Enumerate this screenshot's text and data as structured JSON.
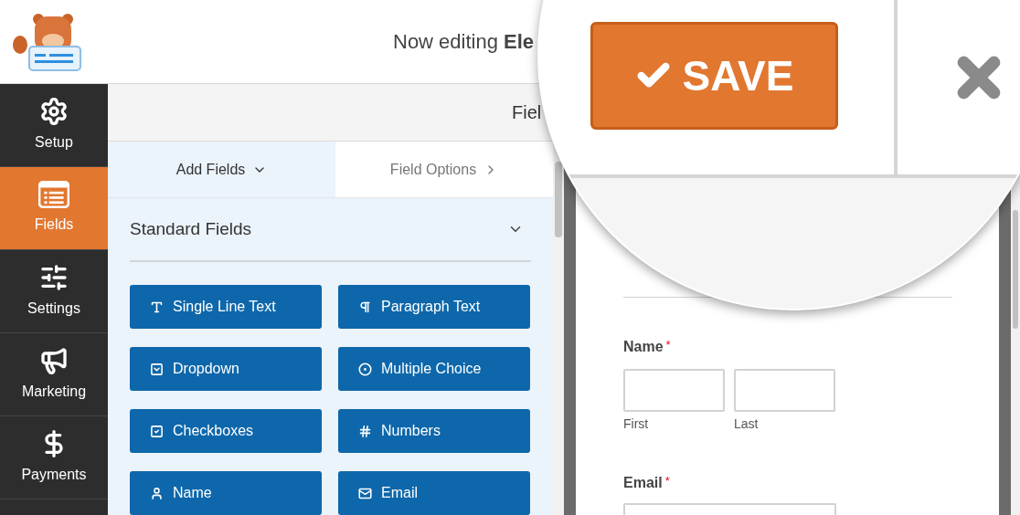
{
  "header": {
    "title": "Now editing **Ele**"
  },
  "sidebar": {
    "items": [
      {
        "label": "Setup",
        "selected": false
      },
      {
        "label": "Fields",
        "selected": true
      },
      {
        "label": "Settings",
        "selected": false
      },
      {
        "label": "Marketing",
        "selected": false
      },
      {
        "label": "Payments",
        "selected": false
      }
    ]
  },
  "panel_header": {
    "title": "Fiel"
  },
  "tabs": [
    {
      "label": "Add Fields",
      "selected": true
    },
    {
      "label": "Field Options",
      "selected": false
    }
  ],
  "section": {
    "title": "Standard Fields",
    "expanded": true
  },
  "field_buttons": [
    "Single Line Text",
    "Paragraph Text",
    "Dropdown",
    "Multiple Choice",
    "Checkboxes",
    "Numbers",
    "Name",
    "Email"
  ],
  "preview": {
    "fields": [
      {
        "kind": "name",
        "label": "Name",
        "required_mark": "*",
        "sublabels": [
          "First",
          "Last"
        ]
      },
      {
        "kind": "email",
        "label": "Email",
        "required_mark": "*"
      }
    ]
  },
  "magnifier": {
    "save_button": "SAVE"
  }
}
